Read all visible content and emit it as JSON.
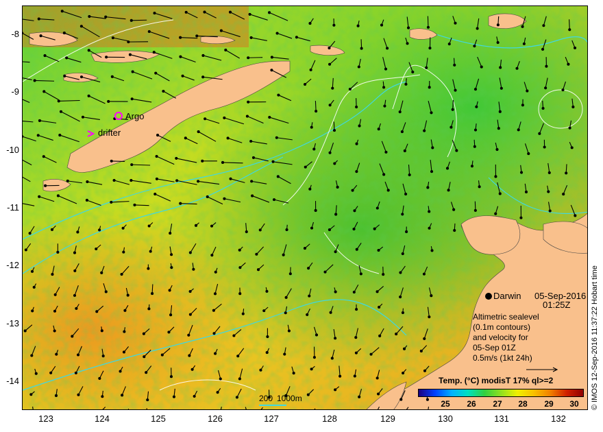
{
  "axes": {
    "lat_ticks": [
      "-8",
      "-9",
      "-10",
      "-11",
      "-12",
      "-13",
      "-14"
    ],
    "lon_ticks": [
      "123",
      "124",
      "125",
      "126",
      "127",
      "128",
      "129",
      "130",
      "131",
      "132"
    ],
    "lon_range": [
      122.6,
      132.6
    ],
    "lat_range": [
      -7.75,
      -14.6
    ]
  },
  "markers": {
    "argo_label": "Argo",
    "drifter_label": "drifter",
    "argo_color": "#ff00ff",
    "drifter_color": "#ff00ff"
  },
  "station": {
    "name": "Darwin",
    "date": "05-Sep-2016",
    "time": "01:25Z"
  },
  "legend": {
    "line1": "Altimetric sealevel",
    "line2": "(0.1m contours)",
    "line3": "and velocity for",
    "line4": "05-Sep 01Z",
    "line5": "0.5m/s (1kt 24h)"
  },
  "scale": {
    "label1": "200",
    "label2": "1000m"
  },
  "colorbar": {
    "title": "Temp. (°C) modisT 17% ql>=2",
    "ticks": [
      "25",
      "26",
      "27",
      "28",
      "29",
      "30"
    ],
    "colors": [
      "#1a0080",
      "#0040ff",
      "#00b0ff",
      "#00e0c0",
      "#30d040",
      "#90e020",
      "#f0f000",
      "#f8c000",
      "#f08000",
      "#d02000",
      "#900000"
    ]
  },
  "credit": "© IMOS 12-Sep-2016 11:37:22 Hobart time",
  "colors": {
    "land": "#f9c08c",
    "sea_green": "#3cc83c",
    "sea_yellow": "#e8e020",
    "sea_orange": "#f0a020",
    "contour": "#40d8e0",
    "sealevel_contour": "#ffffff"
  }
}
